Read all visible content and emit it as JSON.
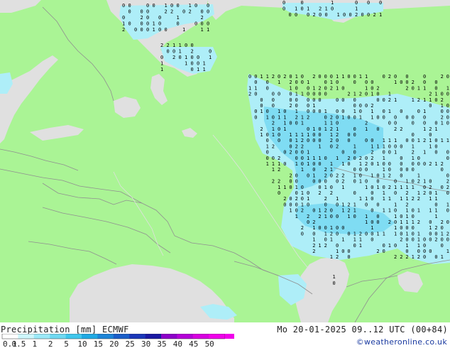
{
  "footer": {
    "title": "Precipitation [mm] ECMWF",
    "valid": "Mo 20-01-2025 09..12 UTC (00+84)",
    "credit": "©weatheronline.co.uk"
  },
  "legend": {
    "labels": [
      "0.1",
      "0.5",
      "1",
      "2",
      "5",
      "10",
      "15",
      "20",
      "25",
      "30",
      "35",
      "40",
      "45",
      "50"
    ],
    "colors": [
      "#ffffff",
      "#cdf6fb",
      "#9ce9f7",
      "#6fd8f1",
      "#3fc6ec",
      "#1fa9e3",
      "#1c84d7",
      "#1a5ec8",
      "#1a36b8",
      "#1a18a2",
      "#8c00c8",
      "#b400d7",
      "#d700e0",
      "#f000ea",
      "#f000ea"
    ]
  },
  "colors": {
    "land": "#aaf495",
    "sea": "#e0e0e0",
    "border": "#909090",
    "rain_light": "#aeeef8",
    "rain_mid": "#7fdcf3",
    "mark_text": "#000000"
  }
}
